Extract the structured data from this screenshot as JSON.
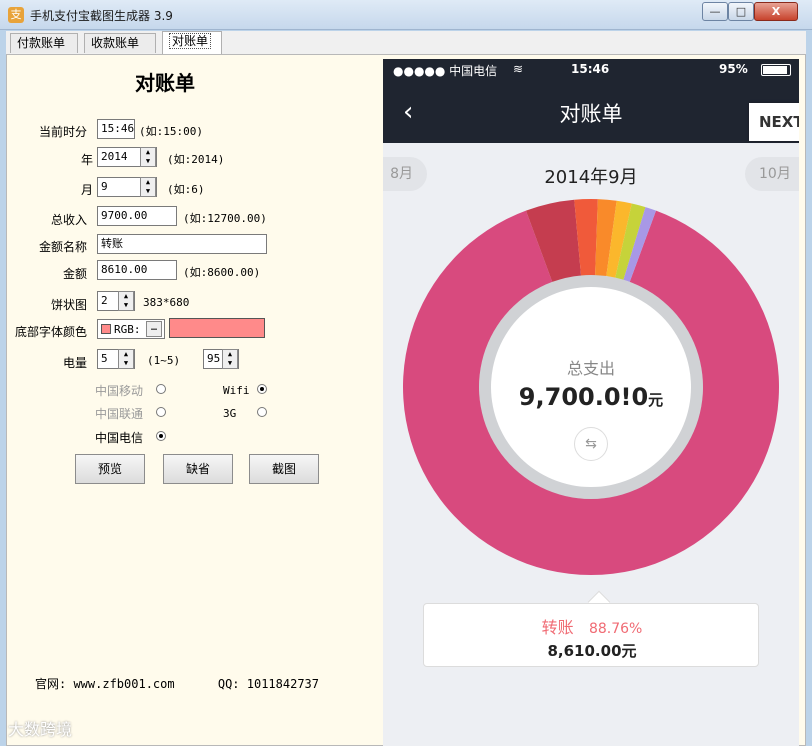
{
  "window": {
    "title": "手机支付宝截图生成器 3.9",
    "icon": "app-icon",
    "min": "—",
    "max": "□",
    "close": "X"
  },
  "tabs": [
    {
      "label": "付款账单",
      "active": false
    },
    {
      "label": "收款账单",
      "active": false
    },
    {
      "label": "对账单",
      "active": true
    }
  ],
  "form": {
    "heading": "对账单",
    "time_label": "当前时分",
    "time_value": "15:46",
    "time_hint": "(如:15:00)",
    "year_label": "年",
    "year_value": "2014",
    "year_hint": "(如:2014)",
    "month_label": "月",
    "month_value": "9",
    "month_hint": "(如:6)",
    "income_label": "总收入",
    "income_value": "9700.00",
    "income_hint": "(如:12700.00)",
    "name_label": "金额名称",
    "name_value": "转账",
    "amount_label": "金额",
    "amount_value": "8610.00",
    "amount_hint": "(如:8600.00)",
    "pie_label": "饼状图",
    "pie_value": "2",
    "pie_size": "383*680",
    "color_label": "底部字体颜色",
    "color_rgb": "RGB:",
    "color_dots": "…",
    "color_swatch": "#ff8a8a",
    "battery_label": "电量",
    "battery_value": "5",
    "battery_hint": "(1~5)",
    "battery_percent": "95",
    "carriers": [
      "中国移动",
      "中国联通",
      "中国电信"
    ],
    "networks": [
      "Wifi",
      "3G"
    ],
    "preview": "预览",
    "default": "缺省",
    "screenshot": "截图"
  },
  "footer": {
    "website": "官网: www.zfb001.com",
    "qq": "QQ: 1011842737"
  },
  "watermark": "大数跨境",
  "phone": {
    "carrier": "●●●●● 中国电信",
    "time": "15:46",
    "battery": "95%",
    "nav_title": "对账单",
    "next": "NEXT",
    "prev_month": "8月",
    "current_month": "2014年9月",
    "next_month": "10月",
    "center_label": "总支出",
    "center_amount": "9,700.0!0",
    "center_unit": "元",
    "callout_name": "转账",
    "callout_percent": "88.76%",
    "callout_amount": "8,610.00元"
  },
  "chart_data": {
    "type": "pie",
    "categories": [
      "转账",
      "",
      "",
      "",
      "",
      "",
      ""
    ],
    "values": [
      88.76,
      4.2,
      2.0,
      1.6,
      1.3,
      1.2,
      0.94
    ],
    "colors": [
      "#d84a7e",
      "#c53d4f",
      "#f05a3a",
      "#f98a2a",
      "#fbb72c",
      "#c6d33a",
      "#a898e6"
    ]
  }
}
